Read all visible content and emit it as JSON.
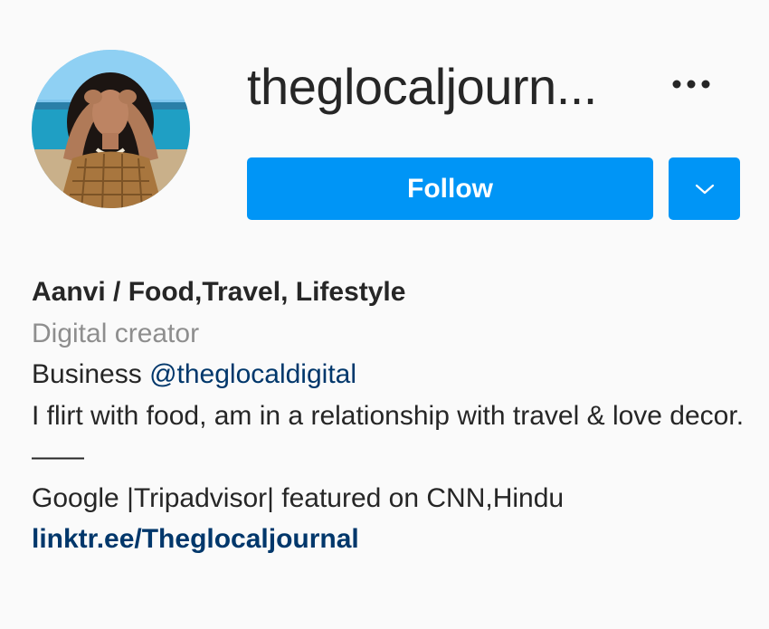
{
  "profile": {
    "username": "theglocaljourn...",
    "full_name": "Aanvi / Food,Travel, Lifestyle",
    "category": "Digital creator",
    "business_prefix": "Business ",
    "business_mention": "@theglocaldigital",
    "bio_text": "I flirt with food, am in a relationship with travel & love decor.",
    "divider": "——",
    "featured": "Google |Tripadvisor| featured on CNN,Hindu",
    "link": "linktr.ee/Theglocaljournal"
  },
  "actions": {
    "follow_label": "Follow",
    "more_icon": "more-horizontal-icon",
    "dropdown_icon": "chevron-down-icon"
  },
  "colors": {
    "follow_button": "#0095f6",
    "link": "#00376b",
    "secondary_text": "#8e8e8e",
    "primary_text": "#262626",
    "background": "#fafafa"
  }
}
